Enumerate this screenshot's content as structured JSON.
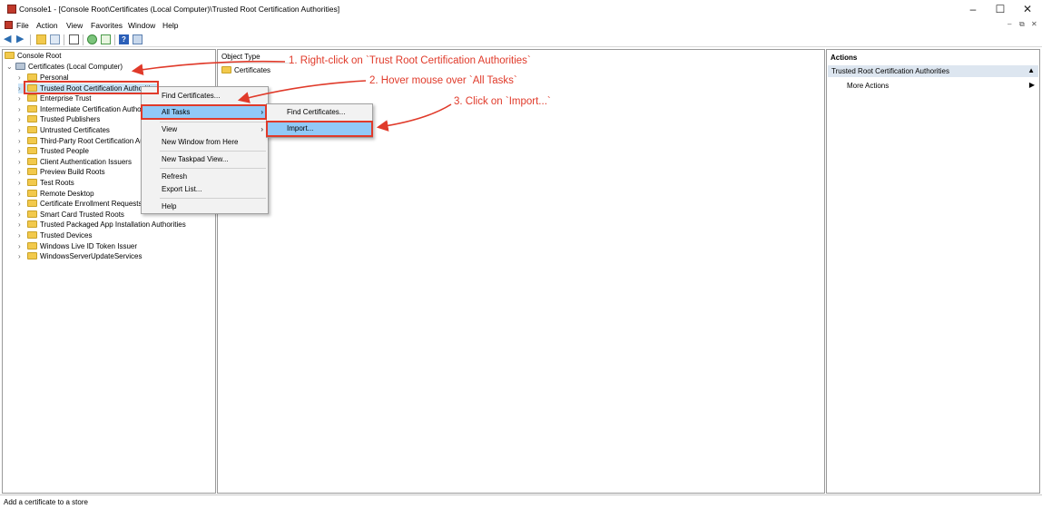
{
  "window": {
    "title": "Console1 - [Console Root\\Certificates (Local Computer)\\Trusted Root Certification Authorities]"
  },
  "menu": [
    "File",
    "Action",
    "View",
    "Favorites",
    "Window",
    "Help"
  ],
  "toolbar_icons": [
    "back-icon",
    "forward-icon",
    "up-folder-icon",
    "show-hide-tree-icon",
    "copy-icon",
    "refresh-icon",
    "export-list-icon",
    "help-icon",
    "properties-icon"
  ],
  "tree": {
    "root": "Console Root",
    "certificates": "Certificates (Local Computer)",
    "items": [
      "Personal",
      "Trusted Root Certification Authorities",
      "Enterprise Trust",
      "Intermediate Certification Authorities",
      "Trusted Publishers",
      "Untrusted Certificates",
      "Third-Party Root Certification Authorities",
      "Trusted People",
      "Client Authentication Issuers",
      "Preview Build Roots",
      "Test Roots",
      "Remote Desktop",
      "Certificate Enrollment Requests",
      "Smart Card Trusted Roots",
      "Trusted Packaged App Installation Authorities",
      "Trusted Devices",
      "Windows Live ID Token Issuer",
      "WindowsServerUpdateServices"
    ]
  },
  "center": {
    "column_header": "Object Type",
    "items": [
      "Certificates"
    ]
  },
  "context_menu": {
    "items": [
      "Find Certificates...",
      "All Tasks",
      "View",
      "New Window from Here",
      "New Taskpad View...",
      "Refresh",
      "Export List...",
      "Help"
    ]
  },
  "submenu": {
    "items": [
      "Find Certificates...",
      "Import..."
    ]
  },
  "actions": {
    "header": "Actions",
    "section": "Trusted Root Certification Authorities",
    "more": "More Actions"
  },
  "annotations": {
    "step1": "1. Right-click on `Trust Root Certification Authorities`",
    "step2": "2. Hover mouse over `All Tasks`",
    "step3": "3. Click on `Import...`"
  },
  "status": "Add a certificate to a store",
  "colors": {
    "highlight": "#91c9f7",
    "annotation_red": "#e03a2a",
    "actions_section_bg": "#dde6f0"
  }
}
